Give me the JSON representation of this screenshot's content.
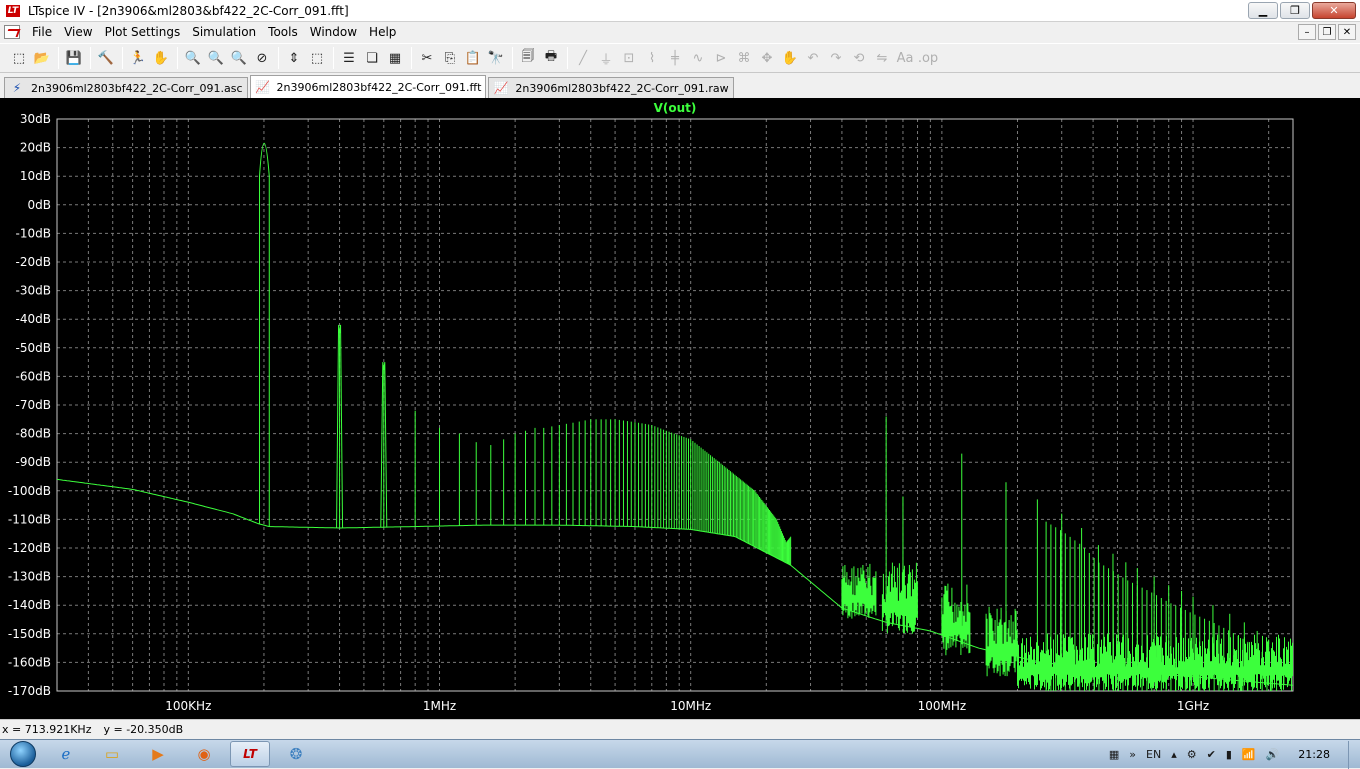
{
  "window": {
    "title": "LTspice IV - [2n3906&ml2803&bf422_2C-Corr_091.fft]",
    "app_logo": "LT",
    "min_label": "▁",
    "max_label": "❐",
    "close_label": "✕"
  },
  "menu": {
    "items": [
      "File",
      "View",
      "Plot Settings",
      "Simulation",
      "Tools",
      "Window",
      "Help"
    ],
    "mdi_min": "–",
    "mdi_restore": "❐",
    "mdi_close": "✕"
  },
  "toolbar": {
    "icons": [
      "new-schematic-icon",
      "open-icon",
      "|",
      "save-icon",
      "|",
      "control-panel-icon",
      "|",
      "run-icon",
      "halt-icon",
      "|",
      "zoom-in-icon",
      "zoom-back-icon",
      "zoom-out-icon",
      "zoom-cancel-icon",
      "|",
      "autorange-icon",
      "zoom-area-icon",
      "|",
      "tile-horizontal-icon",
      "cascade-icon",
      "tile-vertical-icon",
      "|",
      "cut-icon",
      "copy-icon",
      "paste-icon",
      "find-icon",
      "|",
      "print-preview-icon",
      "print-icon",
      "|",
      "wire-icon",
      "ground-icon",
      "label-icon",
      "resistor-icon",
      "capacitor-icon",
      "inductor-icon",
      "diode-icon",
      "component-icon",
      "move-icon",
      "drag-icon",
      "undo-icon",
      "redo-icon",
      "rotate-icon",
      "mirror-icon",
      "text-icon",
      "spice-directive-icon"
    ],
    "glyphs": {
      "new-schematic-icon": "⬚",
      "open-icon": "📂",
      "save-icon": "💾",
      "control-panel-icon": "🔨",
      "run-icon": "🏃",
      "halt-icon": "✋",
      "zoom-in-icon": "🔍",
      "zoom-back-icon": "🔍",
      "zoom-out-icon": "🔍",
      "zoom-cancel-icon": "⊘",
      "autorange-icon": "⇕",
      "zoom-area-icon": "⬚",
      "tile-horizontal-icon": "☰",
      "cascade-icon": "❏",
      "tile-vertical-icon": "▦",
      "cut-icon": "✂",
      "copy-icon": "⎘",
      "paste-icon": "📋",
      "find-icon": "🔭",
      "print-preview-icon": "🗐",
      "print-icon": "🖶",
      "wire-icon": "╱",
      "ground-icon": "⏚",
      "label-icon": "⊡",
      "resistor-icon": "⌇",
      "capacitor-icon": "╪",
      "inductor-icon": "∿",
      "diode-icon": "⊳",
      "component-icon": "⌘",
      "move-icon": "✥",
      "drag-icon": "✋",
      "undo-icon": "↶",
      "redo-icon": "↷",
      "rotate-icon": "⟲",
      "mirror-icon": "⇋",
      "text-icon": "Aa",
      "spice-directive-icon": ".op"
    },
    "dim": [
      "run-icon",
      "halt-icon",
      "wire-icon",
      "ground-icon",
      "label-icon",
      "resistor-icon",
      "capacitor-icon",
      "inductor-icon",
      "diode-icon",
      "component-icon",
      "move-icon",
      "drag-icon",
      "undo-icon",
      "redo-icon",
      "rotate-icon",
      "mirror-icon",
      "text-icon",
      "spice-directive-icon"
    ]
  },
  "tabs": [
    {
      "label": "2n3906ml2803bf422_2C-Corr_091.asc",
      "icon": "schematic-icon",
      "glyph": "⚡",
      "active": false
    },
    {
      "label": "2n3906ml2803bf422_2C-Corr_091.fft",
      "icon": "waveform-icon",
      "glyph": "📈",
      "active": true
    },
    {
      "label": "2n3906ml2803bf422_2C-Corr_091.raw",
      "icon": "waveform-icon",
      "glyph": "📈",
      "active": false
    }
  ],
  "chart_data": {
    "type": "line",
    "title": "V(out)",
    "xscale": "log",
    "xlim": [
      30000,
      2500000000
    ],
    "ylim": [
      -170,
      30
    ],
    "xticks": [
      {
        "value": 100000,
        "label": "100KHz"
      },
      {
        "value": 1000000,
        "label": "1MHz"
      },
      {
        "value": 10000000,
        "label": "10MHz"
      },
      {
        "value": 100000000,
        "label": "100MHz"
      },
      {
        "value": 1000000000,
        "label": "1GHz"
      }
    ],
    "yticks": [
      "30dB",
      "20dB",
      "10dB",
      "0dB",
      "-10dB",
      "-20dB",
      "-30dB",
      "-40dB",
      "-50dB",
      "-60dB",
      "-70dB",
      "-80dB",
      "-90dB",
      "-100dB",
      "-110dB",
      "-120dB",
      "-130dB",
      "-140dB",
      "-150dB",
      "-160dB",
      "-170dB"
    ],
    "grid": true,
    "colors": {
      "background": "#000000",
      "trace": "#3cff3c",
      "grid": "#7a7a7a",
      "frame": "#c8c8c8",
      "labels": "#ffffff",
      "title": "#3cff3c"
    },
    "series": [
      {
        "name": "V(out)",
        "fundamental_hz": 200000,
        "baseline": [
          [
            30000,
            -96
          ],
          [
            60000,
            -99.5
          ],
          [
            100000,
            -104
          ],
          [
            150000,
            -108
          ],
          [
            190000,
            -111.5
          ],
          [
            210000,
            -112.5
          ],
          [
            400000,
            -113
          ],
          [
            800000,
            -112.5
          ],
          [
            1500000,
            -112
          ],
          [
            3000000,
            -112
          ],
          [
            6000000,
            -112.5
          ],
          [
            10000000,
            -113.5
          ],
          [
            15000000,
            -116
          ],
          [
            25000000,
            -126
          ],
          [
            40000000,
            -141
          ],
          [
            60000000,
            -146
          ],
          [
            90000000,
            -149
          ],
          [
            140000000,
            -155
          ],
          [
            250000000,
            -160
          ],
          [
            500000000,
            -163
          ],
          [
            1000000000,
            -165
          ],
          [
            2500000000,
            -168
          ]
        ],
        "peaks": [
          [
            200000,
            25
          ],
          [
            400000,
            -45
          ],
          [
            600000,
            -58
          ],
          [
            800000,
            -72
          ],
          [
            1000000,
            -78
          ],
          [
            1200000,
            -80
          ],
          [
            1400000,
            -83
          ],
          [
            1600000,
            -84
          ],
          [
            1800000,
            -82
          ],
          [
            2000000,
            -80
          ],
          [
            2200000,
            -79
          ],
          [
            2400000,
            -78
          ],
          [
            2600000,
            -78
          ],
          [
            3000000,
            -77
          ],
          [
            3500000,
            -76
          ],
          [
            4000000,
            -75
          ],
          [
            5000000,
            -75
          ],
          [
            6000000,
            -76
          ],
          [
            7000000,
            -77
          ],
          [
            8000000,
            -79
          ],
          [
            10000000,
            -82
          ],
          [
            13000000,
            -90
          ],
          [
            18000000,
            -100
          ],
          [
            22000000,
            -110
          ],
          [
            24000000,
            -118
          ],
          [
            60000000,
            -74
          ],
          [
            70000000,
            -102
          ],
          [
            120000000,
            -87
          ],
          [
            180000000,
            -97
          ],
          [
            240000000,
            -103
          ],
          [
            300000000,
            -108
          ],
          [
            360000000,
            -113
          ],
          [
            420000000,
            -119
          ],
          [
            480000000,
            -122
          ],
          [
            540000000,
            -125
          ],
          [
            600000000,
            -127
          ],
          [
            700000000,
            -130
          ],
          [
            800000000,
            -133
          ],
          [
            900000000,
            -135
          ],
          [
            1000000000,
            -137
          ],
          [
            1200000000,
            -140
          ],
          [
            1400000000,
            -143
          ],
          [
            1600000000,
            -146
          ],
          [
            1800000000,
            -149
          ],
          [
            2000000000,
            -152
          ],
          [
            2300000000,
            -155
          ]
        ],
        "noise_bursts": [
          [
            40000000,
            55000000,
            -125,
            -145
          ],
          [
            58000000,
            80000000,
            -125,
            -150
          ],
          [
            100000000,
            130000000,
            -132,
            -158
          ],
          [
            150000000,
            200000000,
            -140,
            -165
          ],
          [
            200000000,
            2500000000,
            -150,
            -170
          ]
        ]
      }
    ]
  },
  "status": {
    "x_readout": "x = 713.921KHz",
    "y_readout": "y = -20.350dB"
  },
  "taskbar": {
    "apps": [
      {
        "name": "ie-icon",
        "glyph": "ℯ",
        "color": "#1e6fc4",
        "active": false
      },
      {
        "name": "explorer-icon",
        "glyph": "▭",
        "color": "#d9a320",
        "active": false
      },
      {
        "name": "media-player-icon",
        "glyph": "▶",
        "color": "#e47a1b",
        "active": false
      },
      {
        "name": "firefox-icon",
        "glyph": "◉",
        "color": "#e06214",
        "active": false
      },
      {
        "name": "ltspice-icon",
        "glyph": "LT",
        "color": "#c00000",
        "active": true
      },
      {
        "name": "app-icon",
        "glyph": "❂",
        "color": "#3c7fbf",
        "active": false
      }
    ],
    "tray_icons": [
      "▦",
      "»",
      "EN",
      "▴",
      "⚙",
      "✔",
      "▮",
      "📶",
      "🔊"
    ],
    "language": "EN",
    "clock": "21:28"
  }
}
